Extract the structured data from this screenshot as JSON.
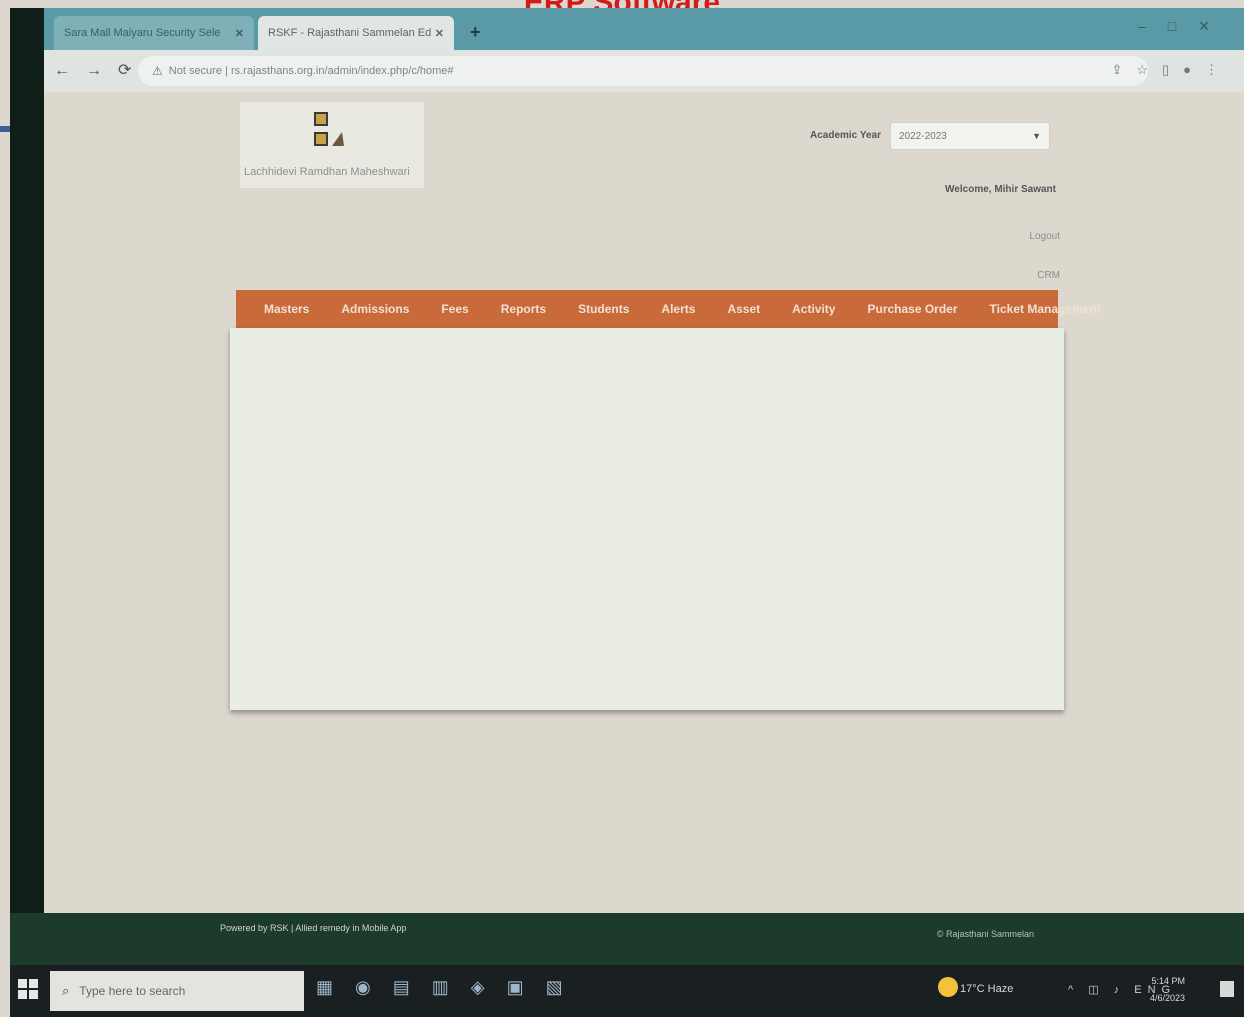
{
  "slide": {
    "title": "ERP Software"
  },
  "browser": {
    "tabs": [
      {
        "label": "Sara Mall Maiyaru Security Sele",
        "active": false
      },
      {
        "label": "RSKF - Rajasthani Sammelan Ed",
        "active": true
      }
    ],
    "new_tab": "+",
    "address": {
      "security": "Not secure",
      "url": "rs.rajasthans.org.in/admin/index.php/c/home#"
    }
  },
  "page": {
    "logo_text": "Lachhidevi Ramdhan Maheshwari",
    "academic_year_label": "Academic Year",
    "academic_year_value": "2022-2023",
    "welcome": "Welcome, Mihir Sawant",
    "logout": "Logout",
    "crm": "CRM",
    "menu": [
      "Masters",
      "Admissions",
      "Fees",
      "Reports",
      "Students",
      "Alerts",
      "Asset",
      "Activity",
      "Purchase Order",
      "Ticket Management"
    ],
    "footer_left": "Powered by RSK | Allied remedy in Mobile App",
    "footer_right": "© Rajasthani Sammelan"
  },
  "taskbar": {
    "search_placeholder": "Type here to search",
    "weather": "17°C Haze",
    "clock_time": "5:14 PM",
    "clock_date": "4/6/2023",
    "lang": "ENG"
  },
  "colors": {
    "menu_bar": "#c96a3a",
    "title_red": "#d41a1a",
    "tab_bar": "#5a9aa6"
  }
}
